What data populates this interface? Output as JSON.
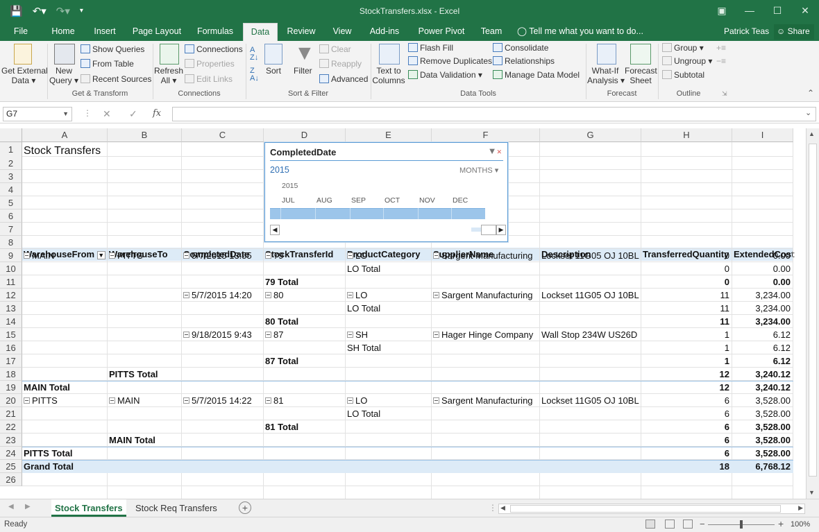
{
  "window": {
    "title": "StockTransfers.xlsx - Excel",
    "user": "Patrick Teas",
    "share": "Share"
  },
  "tabs": [
    "File",
    "Home",
    "Insert",
    "Page Layout",
    "Formulas",
    "Data",
    "Review",
    "View",
    "Add-ins",
    "Power Pivot",
    "Team"
  ],
  "active_tab": "Data",
  "tell_me": "Tell me what you want to do...",
  "ribbon": {
    "get_external_data": [
      "Get External",
      "Data"
    ],
    "new_query": [
      "New",
      "Query"
    ],
    "show_queries": "Show Queries",
    "from_table": "From Table",
    "recent_sources": "Recent Sources",
    "group_get_transform": "Get & Transform",
    "refresh_all": [
      "Refresh",
      "All"
    ],
    "connections": "Connections",
    "properties": "Properties",
    "edit_links": "Edit Links",
    "group_connections": "Connections",
    "sort": "Sort",
    "filter": "Filter",
    "clear": "Clear",
    "reapply": "Reapply",
    "advanced": "Advanced",
    "group_sort_filter": "Sort & Filter",
    "text_to_columns": [
      "Text to",
      "Columns"
    ],
    "flash_fill": "Flash Fill",
    "remove_duplicates": "Remove Duplicates",
    "data_validation": "Data Validation",
    "consolidate": "Consolidate",
    "relationships": "Relationships",
    "manage_data_model": "Manage Data Model",
    "group_data_tools": "Data Tools",
    "what_if": [
      "What-If",
      "Analysis"
    ],
    "forecast_sheet": [
      "Forecast",
      "Sheet"
    ],
    "group_forecast": "Forecast",
    "group": "Group",
    "ungroup": "Ungroup",
    "subtotal": "Subtotal",
    "group_outline": "Outline"
  },
  "formula_bar": {
    "name_box": "G7",
    "formula": "",
    "fx": "fx"
  },
  "columns": [
    "A",
    "B",
    "C",
    "D",
    "E",
    "F",
    "G",
    "H",
    "I"
  ],
  "rows": [
    "1",
    "2",
    "3",
    "4",
    "5",
    "6",
    "7",
    "8",
    "9",
    "10",
    "11",
    "12",
    "13",
    "14",
    "15",
    "16",
    "17",
    "18",
    "19",
    "20",
    "21",
    "22",
    "23",
    "24",
    "25",
    "26"
  ],
  "sheet_title": "Stock Transfers",
  "pivot_headers": [
    "WarehouseFrom",
    "WarehouseTo",
    "CompletedDate",
    "StockTransferId",
    "ProductCategory",
    "SupplierName",
    "Description",
    "TransferredQuantity",
    "ExtendedCost"
  ],
  "pivot_rows": [
    {
      "a": "MAIN",
      "b": "PITTS",
      "c": "5/7/2015 13:55",
      "d": "79",
      "e": "LO",
      "f": "Sargent Manufacturing",
      "g": "Lockset 11G05 OJ 10BL",
      "h": "0",
      "i": "0.00"
    },
    {
      "e": "LO Total",
      "h": "0",
      "i": "0.00"
    },
    {
      "d": "79 Total",
      "h": "0",
      "i": "0.00"
    },
    {
      "c": "5/7/2015 14:20",
      "d": "80",
      "e": "LO",
      "f": "Sargent Manufacturing",
      "g": "Lockset 11G05 OJ 10BL",
      "h": "11",
      "i": "3,234.00"
    },
    {
      "e": "LO Total",
      "h": "11",
      "i": "3,234.00"
    },
    {
      "d": "80 Total",
      "h": "11",
      "i": "3,234.00"
    },
    {
      "c": "9/18/2015 9:43",
      "d": "87",
      "e": "SH",
      "f": "Hager Hinge Company",
      "g": "Wall Stop 234W US26D",
      "h": "1",
      "i": "6.12"
    },
    {
      "e": "SH Total",
      "h": "1",
      "i": "6.12"
    },
    {
      "d": "87 Total",
      "h": "1",
      "i": "6.12"
    },
    {
      "b": "PITTS Total",
      "h": "12",
      "i": "3,240.12"
    },
    {
      "a": "MAIN Total",
      "h": "12",
      "i": "3,240.12"
    },
    {
      "a": "PITTS",
      "b": "MAIN",
      "c": "5/7/2015 14:22",
      "d": "81",
      "e": "LO",
      "f": "Sargent Manufacturing",
      "g": "Lockset 11G05 OJ 10BL",
      "h": "6",
      "i": "3,528.00"
    },
    {
      "e": "LO Total",
      "h": "6",
      "i": "3,528.00"
    },
    {
      "d": "81 Total",
      "h": "6",
      "i": "3,528.00"
    },
    {
      "b": "MAIN Total",
      "h": "6",
      "i": "3,528.00"
    },
    {
      "a": "PITTS Total",
      "h": "6",
      "i": "3,528.00"
    },
    {
      "a": "Grand Total",
      "h": "18",
      "i": "6,768.12"
    }
  ],
  "slicer": {
    "title": "CompletedDate",
    "year_link": "2015",
    "time_level": "MONTHS",
    "year_label": "2015",
    "months": [
      "JUL",
      "AUG",
      "SEP",
      "OCT",
      "NOV",
      "DEC"
    ]
  },
  "sheets": [
    "Stock Transfers",
    "Stock Req Transfers"
  ],
  "active_sheet": "Stock Transfers",
  "status": {
    "ready": "Ready",
    "zoom": "100%"
  }
}
